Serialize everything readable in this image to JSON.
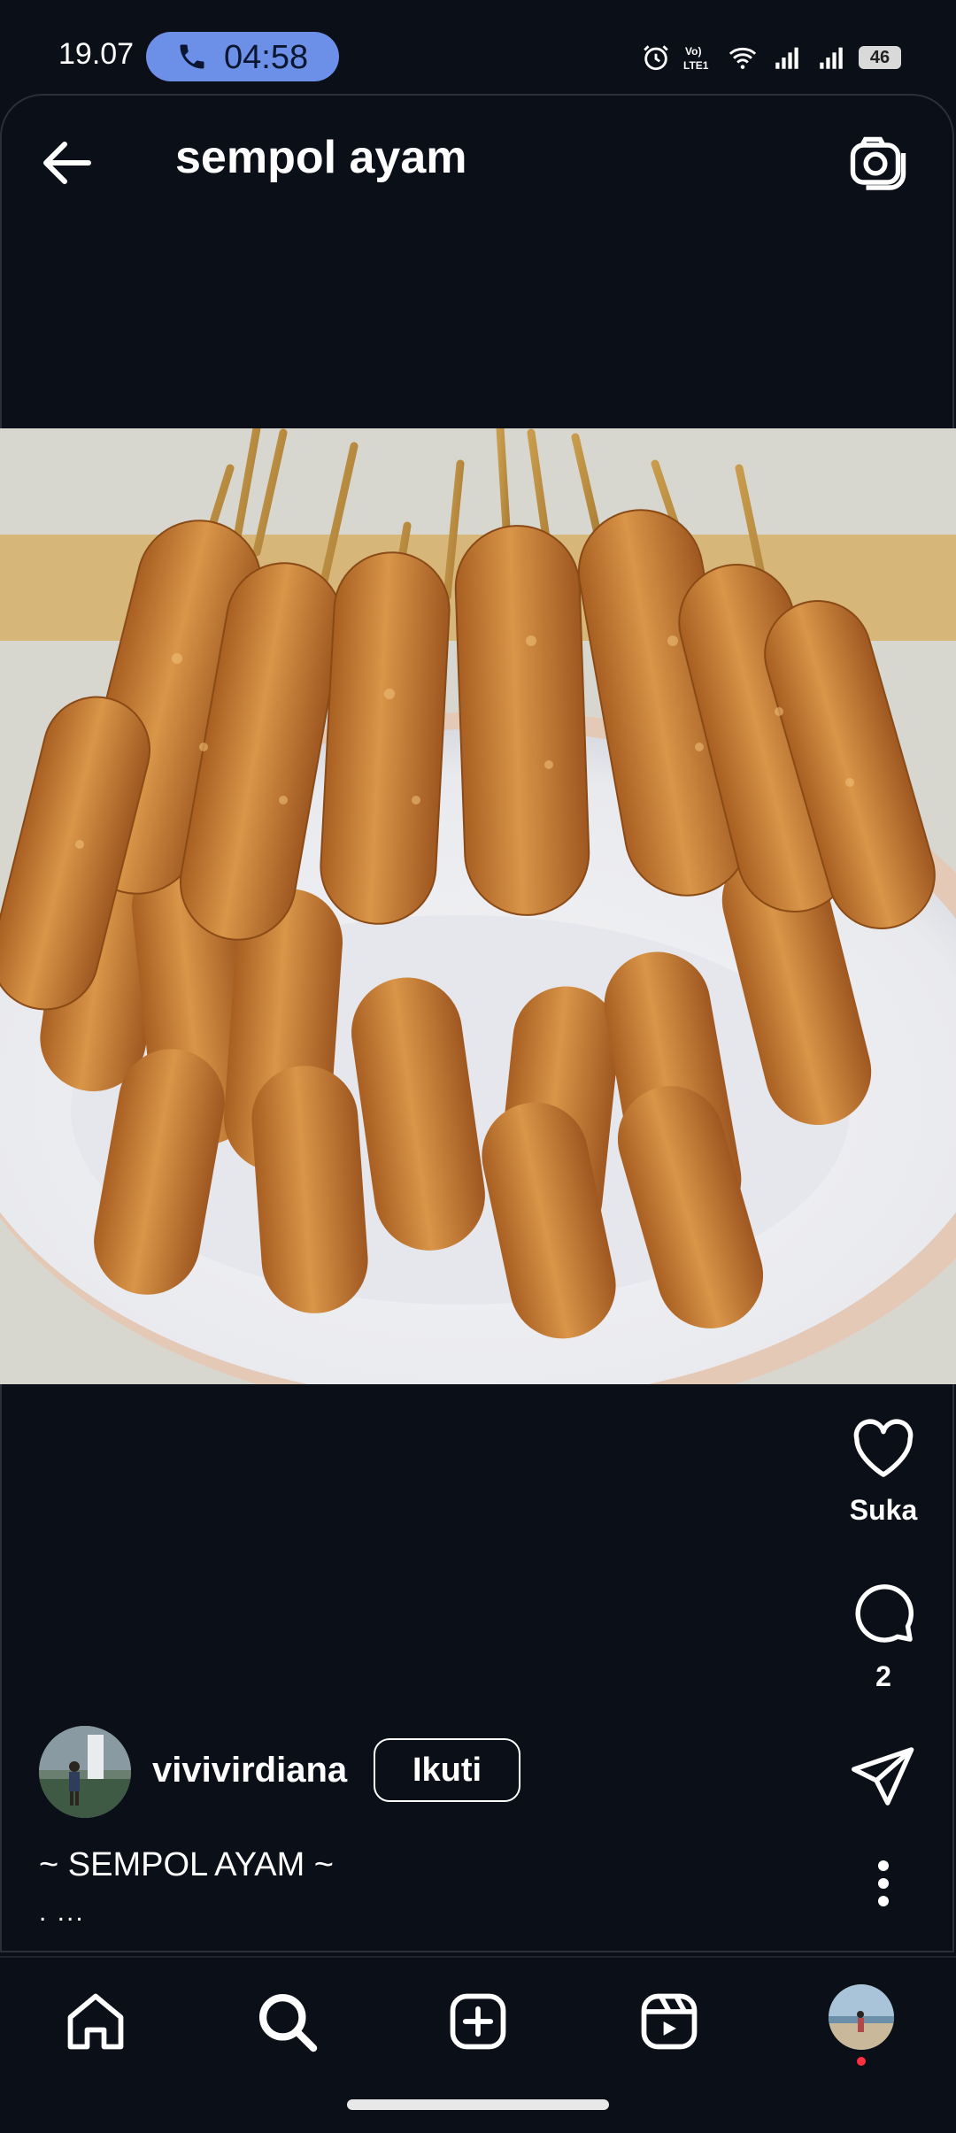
{
  "status_bar": {
    "time": "19.07",
    "call_duration": "04:58",
    "battery": "46"
  },
  "header": {
    "title": "sempol ayam"
  },
  "actions": {
    "like_label": "Suka",
    "comment_count": "2"
  },
  "post": {
    "username": "vivivirdiana",
    "follow_label": "Ikuti",
    "caption": "~ SEMPOL AYAM ~",
    "caption_more": ". ..."
  },
  "icons": [
    "back-arrow-icon",
    "camera-icon",
    "heart-icon",
    "comment-icon",
    "send-icon",
    "more-icon",
    "home-icon",
    "search-icon",
    "create-icon",
    "reels-icon",
    "profile-avatar"
  ],
  "colors": {
    "background": "#0b0f17",
    "call_pill": "#6c8fe8",
    "notification_dot": "#ff3040"
  }
}
